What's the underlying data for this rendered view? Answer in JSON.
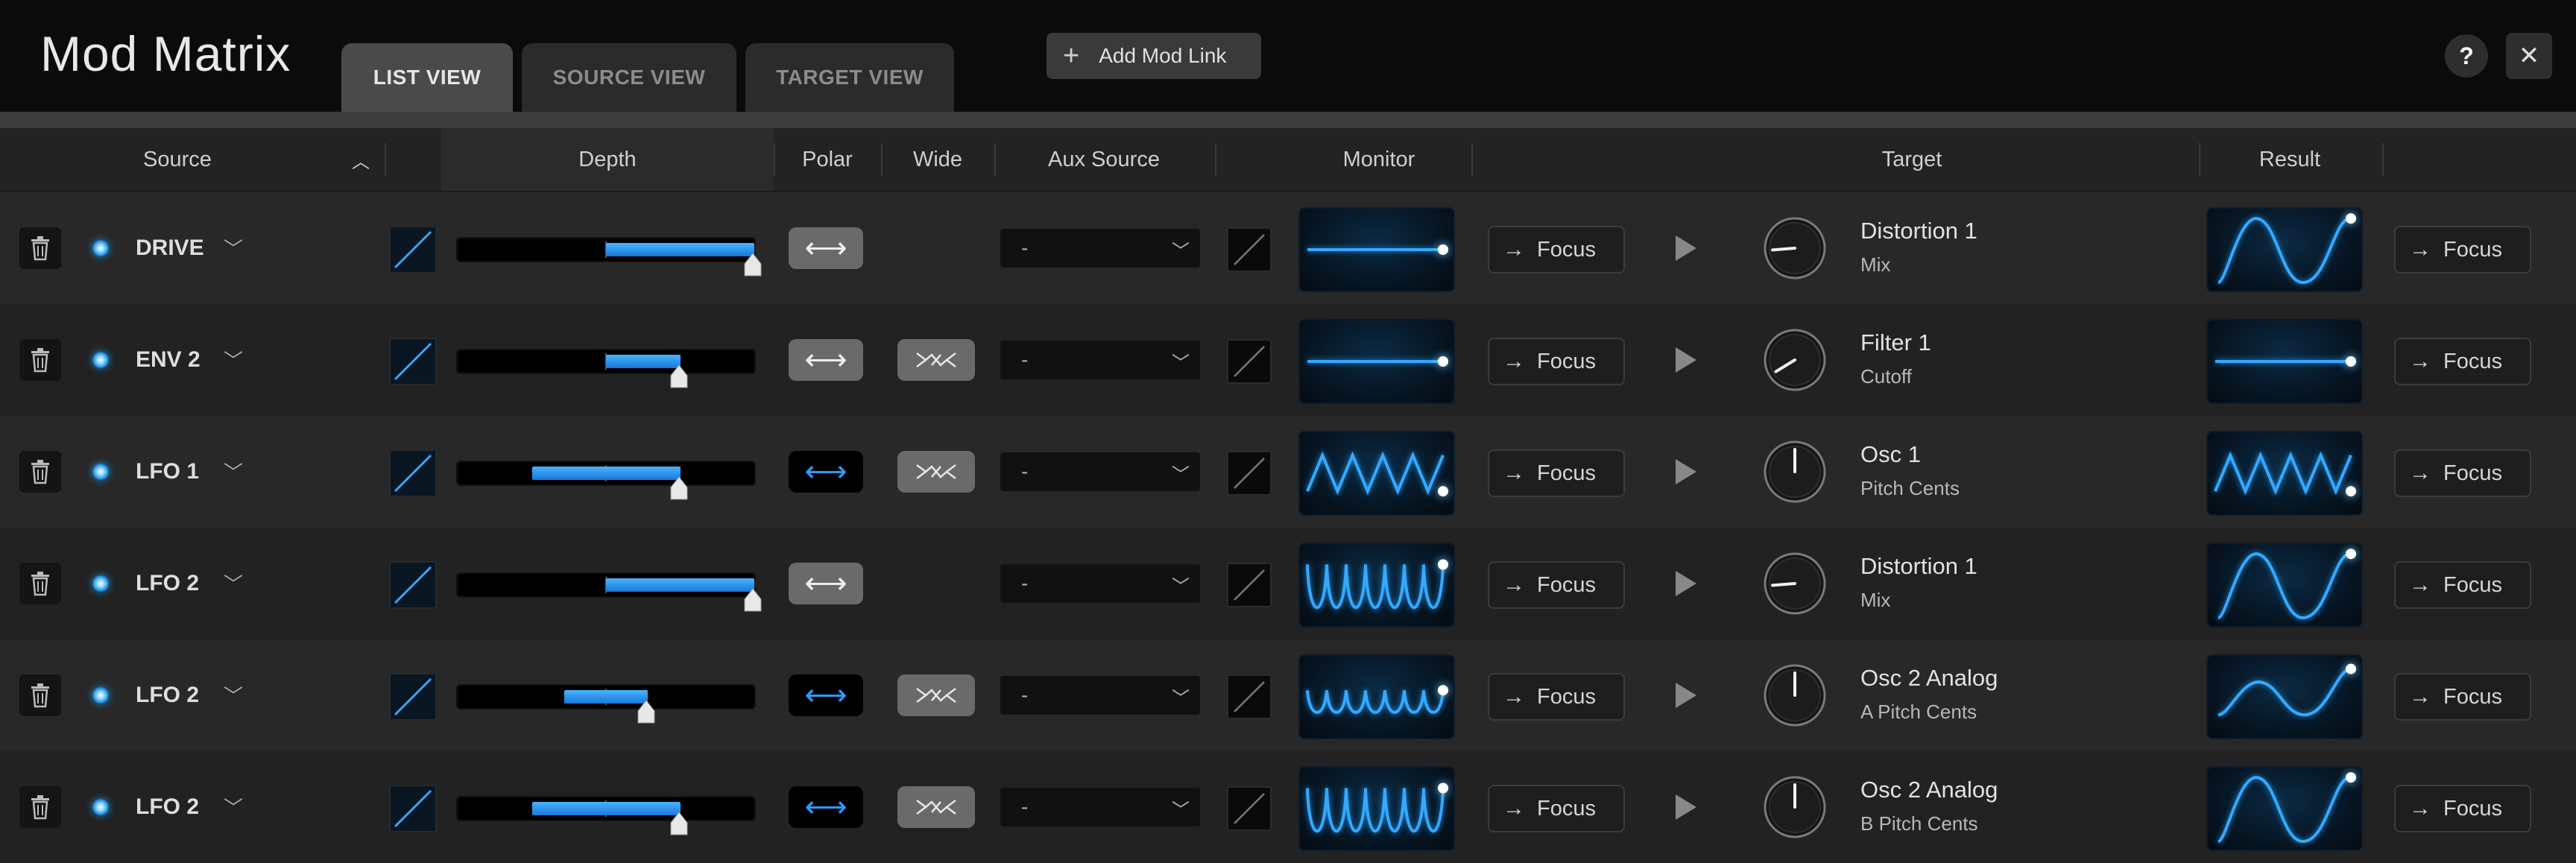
{
  "window": {
    "title": "Mod Matrix",
    "tabs": [
      {
        "label": "LIST VIEW",
        "active": true
      },
      {
        "label": "SOURCE VIEW",
        "active": false
      },
      {
        "label": "TARGET VIEW",
        "active": false
      }
    ],
    "add_button_label": "Add Mod Link",
    "help_label": "?",
    "close_label": "✕"
  },
  "columns": {
    "source": "Source",
    "depth": "Depth",
    "polar": "Polar",
    "wide": "Wide",
    "aux_source": "Aux Source",
    "monitor": "Monitor",
    "target": "Target",
    "result": "Result"
  },
  "focus_label": "Focus",
  "colors": {
    "accent": "#2b9bff",
    "led": "#1a8fe0",
    "background": "#141414"
  },
  "rows": [
    {
      "source": "DRIVE",
      "depth_from": 0.5,
      "depth_to": 1.0,
      "polar": "bipolar",
      "wide": false,
      "aux": "-",
      "monitor_wave": "flat",
      "target": "Distortion 1",
      "param": "Mix",
      "knob": 0.15,
      "result_wave": "shaper"
    },
    {
      "source": "ENV 2",
      "depth_from": 0.5,
      "depth_to": 0.75,
      "polar": "bipolar",
      "wide": true,
      "aux": "-",
      "monitor_wave": "flat",
      "target": "Filter 1",
      "param": "Cutoff",
      "knob": 0.05,
      "result_wave": "flat"
    },
    {
      "source": "LFO 1",
      "depth_from": 0.25,
      "depth_to": 0.75,
      "polar": "unipolar",
      "wide": true,
      "aux": "-",
      "monitor_wave": "triangle",
      "target": "Osc 1",
      "param": "Pitch Cents",
      "knob": 0.5,
      "result_wave": "triangle"
    },
    {
      "source": "LFO 2",
      "depth_from": 0.5,
      "depth_to": 1.0,
      "polar": "bipolar",
      "wide": false,
      "aux": "-",
      "monitor_wave": "bumps",
      "target": "Distortion 1",
      "param": "Mix",
      "knob": 0.15,
      "result_wave": "shaper"
    },
    {
      "source": "LFO 2",
      "depth_from": 0.36,
      "depth_to": 0.64,
      "polar": "unipolar",
      "wide": true,
      "aux": "-",
      "monitor_wave": "bumps-small",
      "target": "Osc 2 Analog",
      "param": "A Pitch Cents",
      "knob": 0.5,
      "result_wave": "shaper-small"
    },
    {
      "source": "LFO 2",
      "depth_from": 0.25,
      "depth_to": 0.75,
      "polar": "unipolar",
      "wide": true,
      "aux": "-",
      "monitor_wave": "bumps",
      "target": "Osc 2 Analog",
      "param": "B Pitch Cents",
      "knob": 0.5,
      "result_wave": "shaper"
    }
  ]
}
